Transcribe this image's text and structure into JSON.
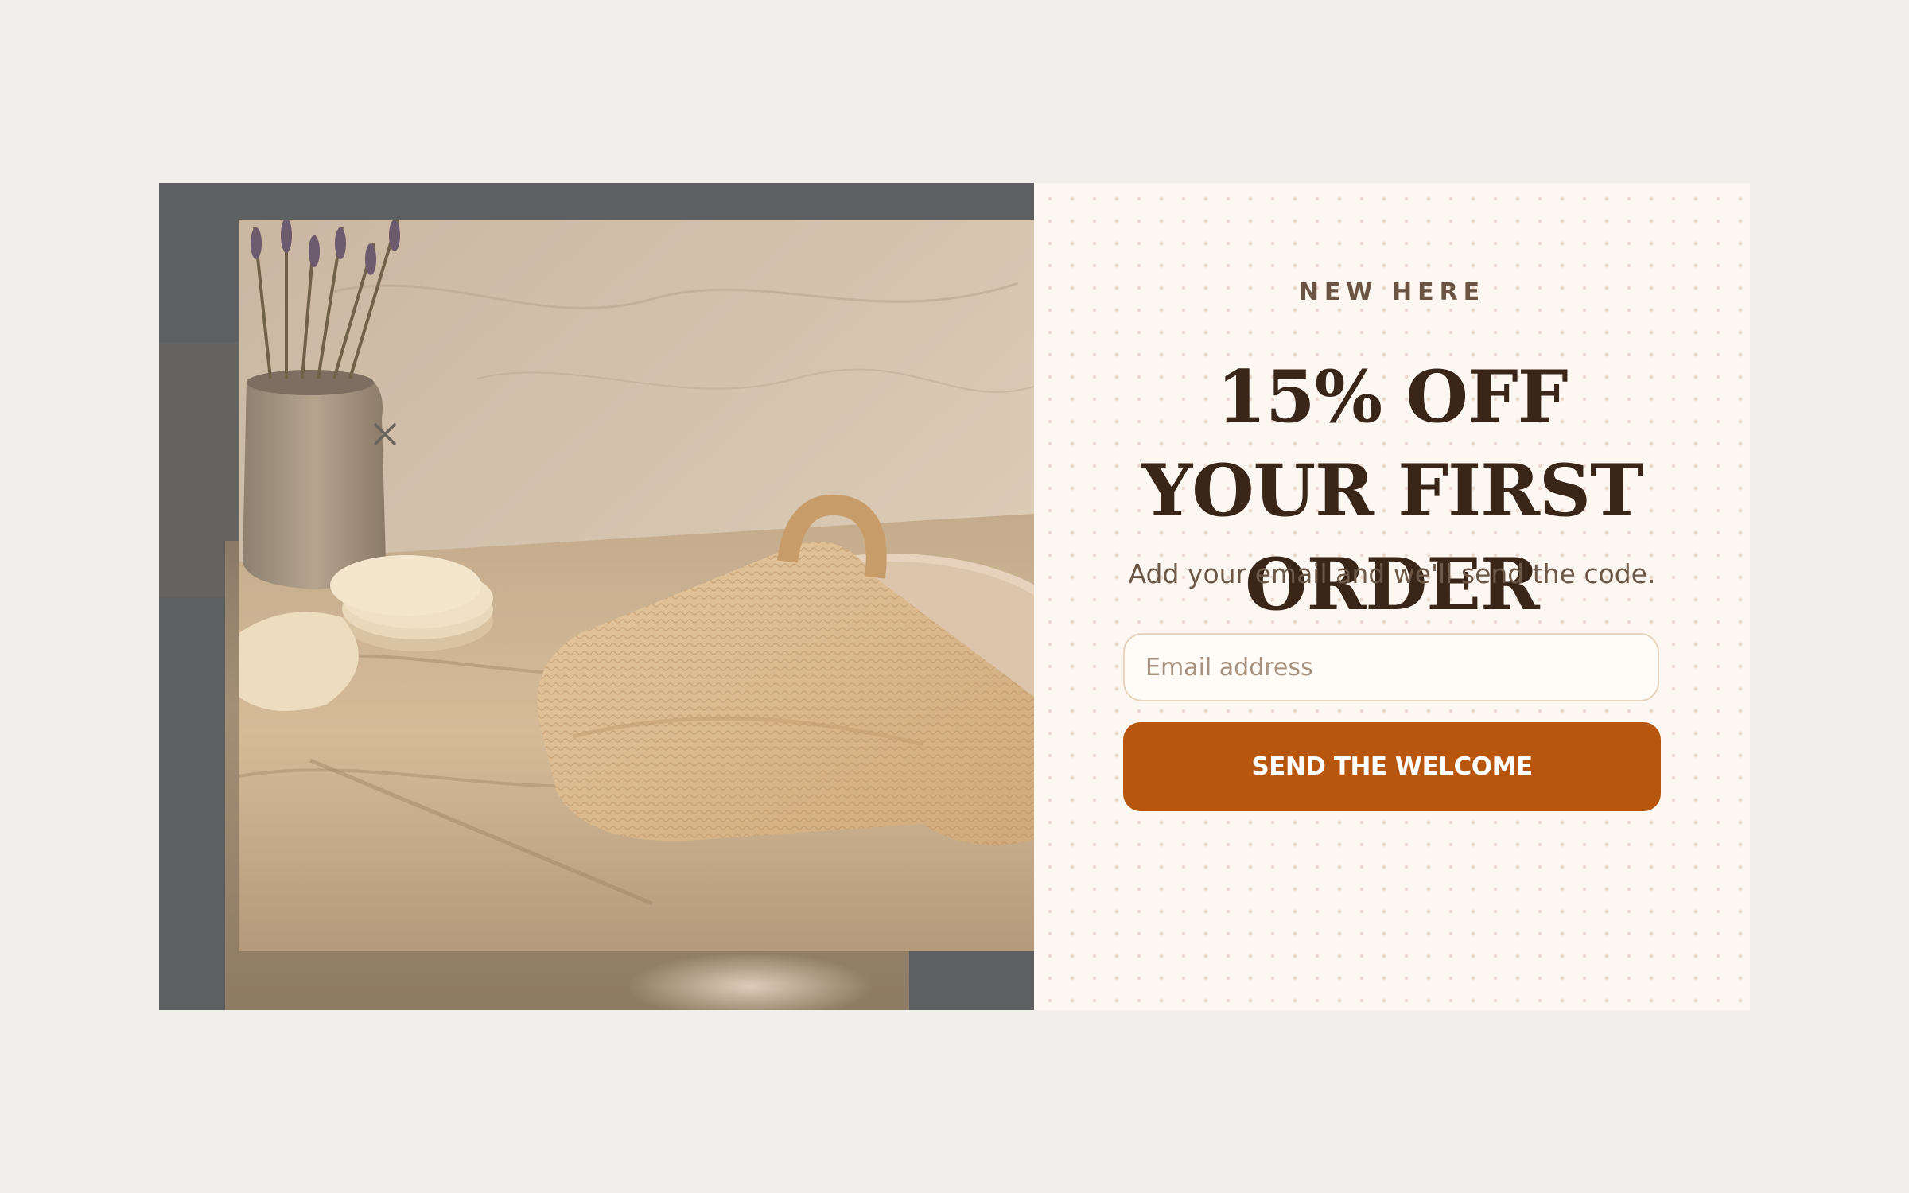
{
  "popup": {
    "eyebrow": "NEW HERE",
    "headline": "15% OFF YOUR FIRST ORDER",
    "subtext": "Add your email and we'll send the code.",
    "email": {
      "placeholder": "Email address",
      "value": ""
    },
    "submit_label": "SEND THE WELCOME",
    "close_icon": "close-icon",
    "image_icon": "product-photo"
  },
  "colors": {
    "page_background": "#f0efeb",
    "panel_background": "#fdf7f2",
    "headline": "#3a2618",
    "button": "#b8560d",
    "button_text": "#ffffff"
  }
}
